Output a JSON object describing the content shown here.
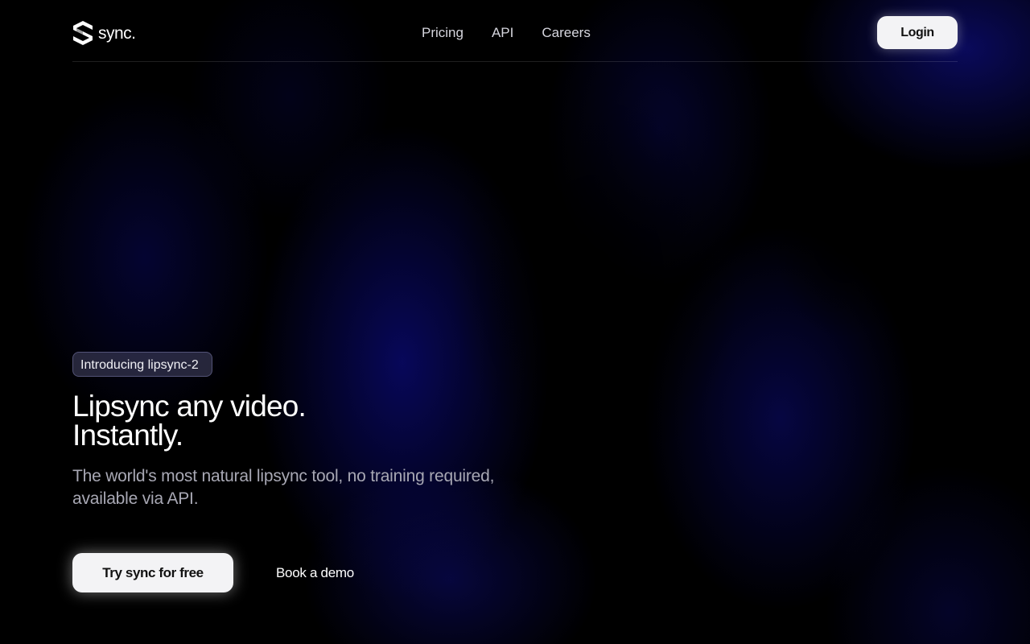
{
  "brand": {
    "name": "sync.",
    "logo_icon": "sync-logo-icon"
  },
  "nav": {
    "items": [
      {
        "label": "Pricing"
      },
      {
        "label": "API"
      },
      {
        "label": "Careers"
      }
    ],
    "login_label": "Login"
  },
  "hero": {
    "badge": "Introducing lipsync-2",
    "title_line1": "Lipsync any video.",
    "title_line2": "Instantly.",
    "subtitle_line1": "The world's most natural lipsync tool, no training required,",
    "subtitle_line2": "available via API."
  },
  "cta": {
    "primary_label": "Try sync for free",
    "secondary_label": "Book a demo"
  },
  "colors": {
    "background": "#000000",
    "glow": "#0a0a78",
    "button_bg": "#f3f3f5",
    "button_text": "#111111",
    "subtitle": "#a8a8b4"
  }
}
